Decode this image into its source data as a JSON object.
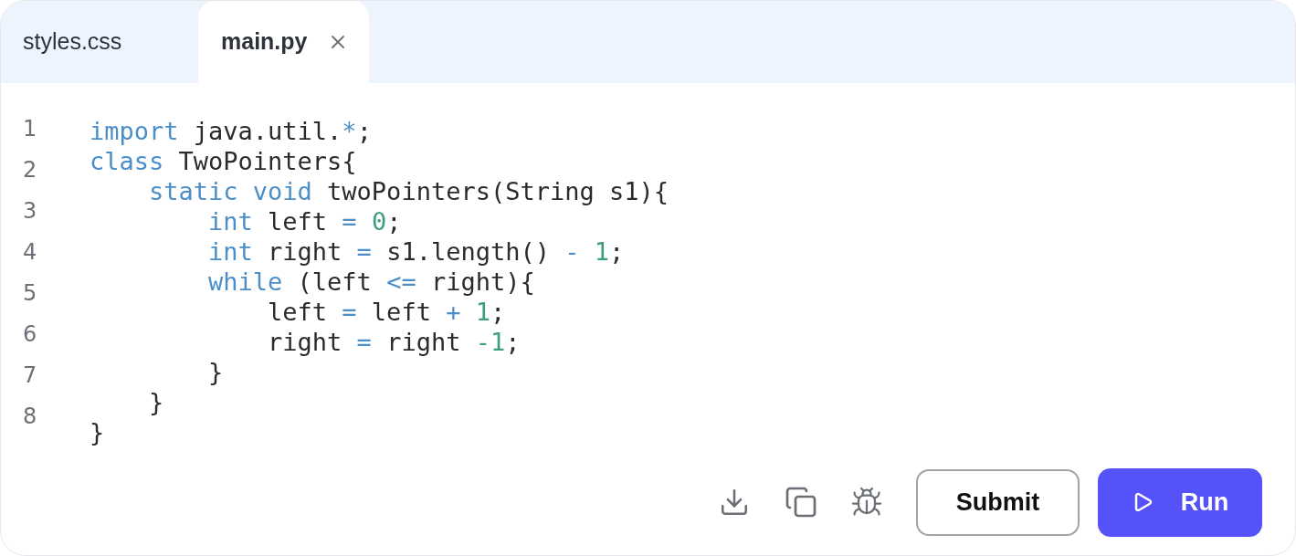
{
  "tabs": [
    {
      "label": "styles.css",
      "selected": false
    },
    {
      "label": "main.py",
      "selected": true
    }
  ],
  "editor": {
    "line_numbers": [
      "1",
      "2",
      "3",
      "4",
      "5",
      "6",
      "7",
      "8"
    ],
    "lines": [
      [
        {
          "kind": "kw",
          "text": "import"
        },
        {
          "kind": "plain",
          "text": " java.util."
        },
        {
          "kind": "op",
          "text": "*"
        },
        {
          "kind": "plain",
          "text": ";"
        }
      ],
      [
        {
          "kind": "kw",
          "text": "class"
        },
        {
          "kind": "plain",
          "text": " TwoPointers{"
        }
      ],
      [
        {
          "kind": "kw",
          "text": "    static void"
        },
        {
          "kind": "plain",
          "text": " twoPointers(String s1){"
        }
      ],
      [
        {
          "kind": "kw",
          "text": "        int"
        },
        {
          "kind": "plain",
          "text": " left "
        },
        {
          "kind": "op",
          "text": "="
        },
        {
          "kind": "num",
          "text": " 0"
        },
        {
          "kind": "plain",
          "text": ";"
        }
      ],
      [
        {
          "kind": "kw",
          "text": "        int"
        },
        {
          "kind": "plain",
          "text": " right "
        },
        {
          "kind": "op",
          "text": "="
        },
        {
          "kind": "plain",
          "text": " s1.length() "
        },
        {
          "kind": "op",
          "text": "-"
        },
        {
          "kind": "num",
          "text": " 1"
        },
        {
          "kind": "plain",
          "text": ";"
        }
      ],
      [
        {
          "kind": "kw",
          "text": "        while"
        },
        {
          "kind": "plain",
          "text": " (left "
        },
        {
          "kind": "op",
          "text": "<="
        },
        {
          "kind": "plain",
          "text": " right){"
        }
      ],
      [
        {
          "kind": "plain",
          "text": "            left "
        },
        {
          "kind": "op",
          "text": "="
        },
        {
          "kind": "plain",
          "text": " left "
        },
        {
          "kind": "op",
          "text": "+"
        },
        {
          "kind": "num",
          "text": " 1"
        },
        {
          "kind": "plain",
          "text": ";"
        }
      ],
      [
        {
          "kind": "plain",
          "text": "            right "
        },
        {
          "kind": "op",
          "text": "="
        },
        {
          "kind": "plain",
          "text": " right "
        },
        {
          "kind": "num",
          "text": "-1"
        },
        {
          "kind": "plain",
          "text": ";"
        }
      ],
      [
        {
          "kind": "plain",
          "text": "        }"
        }
      ],
      [
        {
          "kind": "plain",
          "text": "    }"
        }
      ],
      [
        {
          "kind": "plain",
          "text": "}"
        }
      ]
    ]
  },
  "buttons": {
    "submit": "Submit",
    "run": "Run"
  }
}
